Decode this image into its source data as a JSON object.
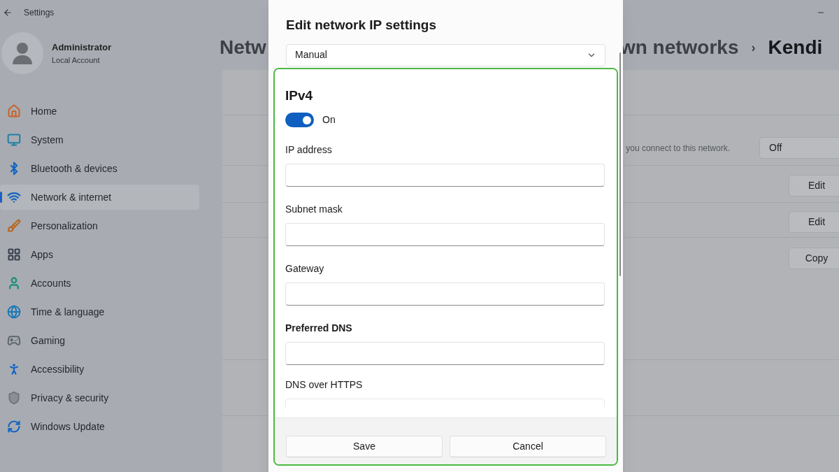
{
  "window": {
    "title": "Settings"
  },
  "account": {
    "name": "Administrator",
    "type": "Local Account"
  },
  "nav": [
    {
      "label": "Home",
      "selected": false
    },
    {
      "label": "System",
      "selected": false
    },
    {
      "label": "Bluetooth & devices",
      "selected": false
    },
    {
      "label": "Network & internet",
      "selected": true
    },
    {
      "label": "Personalization",
      "selected": false
    },
    {
      "label": "Apps",
      "selected": false
    },
    {
      "label": "Accounts",
      "selected": false
    },
    {
      "label": "Time & language",
      "selected": false
    },
    {
      "label": "Gaming",
      "selected": false
    },
    {
      "label": "Accessibility",
      "selected": false
    },
    {
      "label": "Privacy & security",
      "selected": false
    },
    {
      "label": "Windows Update",
      "selected": false
    }
  ],
  "page_title": {
    "start": "Netw",
    "middle": "wn networks",
    "separator": "›",
    "current": "Kendi"
  },
  "background_card": {
    "rows": [
      {
        "kind": "dropdown",
        "description": "you connect to this network.",
        "value": "Off"
      },
      {
        "kind": "button",
        "button": "Edit"
      },
      {
        "kind": "button",
        "button": "Edit"
      },
      {
        "kind": "button",
        "button": "Copy"
      }
    ]
  },
  "dialog": {
    "title": "Edit network IP settings",
    "mode": "Manual",
    "section": "IPv4",
    "toggle": {
      "on": true,
      "label": "On"
    },
    "fields": [
      {
        "label": "IP address",
        "bold": false
      },
      {
        "label": "Subnet mask",
        "bold": false
      },
      {
        "label": "Gateway",
        "bold": false
      },
      {
        "label": "Preferred DNS",
        "bold": true
      }
    ],
    "dns_over_https": {
      "label": "DNS over HTTPS"
    },
    "buttons": [
      "Save",
      "Cancel"
    ]
  },
  "highlight": {
    "color": "#4cb944"
  }
}
